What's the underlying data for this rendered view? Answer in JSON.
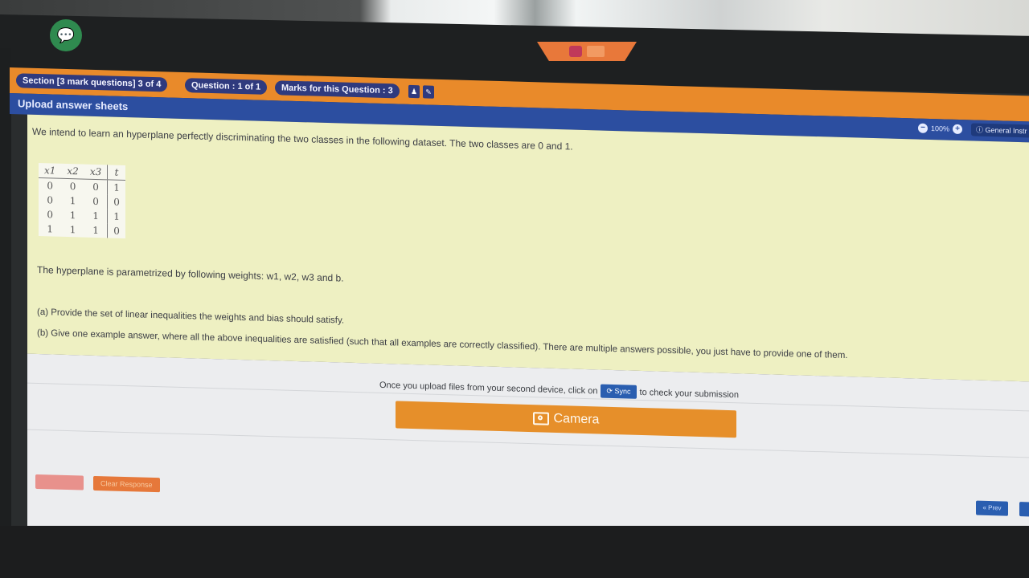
{
  "section": {
    "label": "Section [3 mark questions] 3 of 4",
    "question": "Question : 1 of 1",
    "marks": "Marks for this Question : 3"
  },
  "panel_title": "Upload answer sheets",
  "zoom": {
    "value": "100%",
    "minus_icon": "minus-icon",
    "plus_icon": "plus-icon"
  },
  "general_button": "General Instr",
  "question": {
    "intro": "We intend to learn an hyperplane perfectly discriminating the two classes in the following dataset. The two classes are 0 and 1.",
    "table": {
      "headers": [
        "x1",
        "x2",
        "x3",
        "t"
      ],
      "rows": [
        [
          "0",
          "0",
          "0",
          "1"
        ],
        [
          "0",
          "1",
          "0",
          "0"
        ],
        [
          "0",
          "1",
          "1",
          "1"
        ],
        [
          "1",
          "1",
          "1",
          "0"
        ]
      ]
    },
    "weights_text": "The hyperplane is parametrized by following weights: w1, w2, w3 and b.",
    "part_a": "(a) Provide the set of linear inequalities the weights and bias should satisfy.",
    "part_b": "(b) Give one example answer, where all the above inequalities are satisfied (such that all examples are correctly classified). There are multiple answers possible, you just have to provide one of them."
  },
  "upload": {
    "before": "Once you upload files from your second device, click on",
    "sync_label": "Sync",
    "after": "to check your submission",
    "camera_label": "Camera"
  },
  "footer": {
    "clear_label": "Clear Response",
    "prev_label": "« Prev"
  },
  "colors": {
    "orange": "#e98a2a",
    "blue": "#2c4ea0",
    "question_bg": "#eef0c2"
  }
}
